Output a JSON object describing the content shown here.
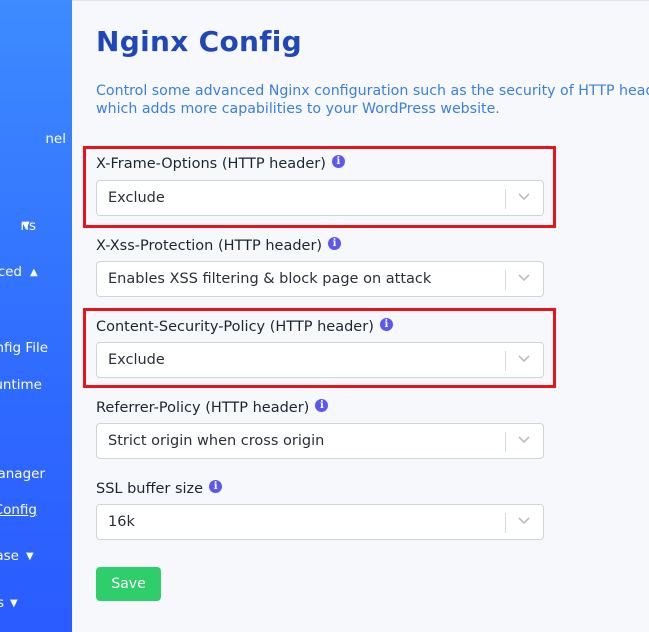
{
  "sidebar": {
    "items": [
      {
        "label": "nel",
        "caret": ""
      },
      {
        "label": "ns",
        "caret": "▼"
      },
      {
        "label": "ced",
        "caret": "▲"
      },
      {
        "label": "nfig File",
        "caret": ""
      },
      {
        "label": "untime",
        "caret": ""
      },
      {
        "label": "anager",
        "caret": ""
      },
      {
        "label": "Config",
        "caret": ""
      },
      {
        "label": "ase",
        "caret": "▼"
      },
      {
        "label": "s",
        "caret": "▼"
      }
    ]
  },
  "page": {
    "title": "Nginx Config",
    "description_line1": "Control some advanced Nginx configuration such as the security of HTTP headers",
    "description_line2": "which adds more capabilities to your WordPress website."
  },
  "fields": [
    {
      "label": "X-Frame-Options (HTTP header)",
      "value": "Exclude",
      "highlighted": true
    },
    {
      "label": "X-Xss-Protection (HTTP header)",
      "value": "Enables XSS filtering & block page on attack",
      "highlighted": false
    },
    {
      "label": "Content-Security-Policy (HTTP header)",
      "value": "Exclude",
      "highlighted": true
    },
    {
      "label": "Referrer-Policy (HTTP header)",
      "value": "Strict origin when cross origin",
      "highlighted": false
    },
    {
      "label": "SSL buffer size",
      "value": "16k",
      "highlighted": false
    }
  ],
  "info_icon": {
    "glyph": "i",
    "name": "info-icon"
  },
  "actions": {
    "save_label": "Save"
  },
  "colors": {
    "sidebar": "#2f6bff",
    "title": "#1f47b8",
    "description": "#3a7fe0",
    "highlight": "#e8141c",
    "save": "#2ecf6a",
    "info": "#5b57f0"
  }
}
